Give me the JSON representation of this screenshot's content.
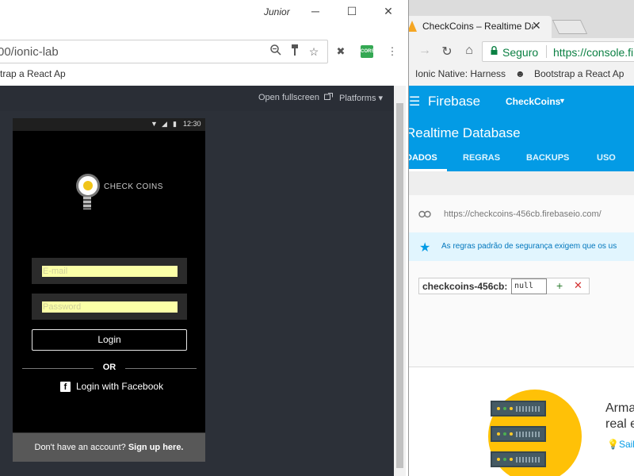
{
  "left_window": {
    "title": "Junior",
    "controls": {
      "minimize": "─",
      "maximize": "☐",
      "close": "✕"
    },
    "address": "00/ionic-lab",
    "cors_badge": "CORS",
    "bookmark": "trap a React Ap",
    "ionic_lab": {
      "open_fullscreen": "Open fullscreen",
      "platforms": "Platforms ▾",
      "status_time": "12:30",
      "logo_text": "CHECK COINS",
      "email_placeholder": "E-mail",
      "password_placeholder": "Password",
      "login_button": "Login",
      "or_text": "OR",
      "facebook_icon": "f",
      "facebook_button": "Login with Facebook",
      "signup_prompt": "Don't have an account?",
      "signup_link": "Sign up here."
    }
  },
  "right_window": {
    "tab_title": "CheckCoins – Realtime Da",
    "tab_close": "✕",
    "nav": {
      "forward": "→",
      "reload": "↻",
      "home": "⌂"
    },
    "secure_label": "Seguro",
    "url": "https://console.fi",
    "bookmarks": [
      "Ionic Native: Harness",
      "Bootstrap a React Ap"
    ],
    "firebase": {
      "brand": "Firebase",
      "project": "CheckCoins",
      "page_title": "Realtime Database",
      "tabs": [
        "DADOS",
        "REGRAS",
        "BACKUPS",
        "USO"
      ],
      "db_url": "https://checkcoins-456cb.firebaseio.com/",
      "banner": "As regras padrão de segurança exigem que os us",
      "node_key": "checkcoins-456cb:",
      "node_value": "null",
      "add_symbol": "+",
      "delete_symbol": "✕",
      "promo_heading_1": "Arma",
      "promo_heading_2": "real e",
      "promo_link": "Saib"
    }
  },
  "colors": {
    "firebase_blue": "#039be5",
    "ionic_dark": "#2c3038",
    "field_yellow": "#fbffa7",
    "secure_green": "#0b8043"
  }
}
